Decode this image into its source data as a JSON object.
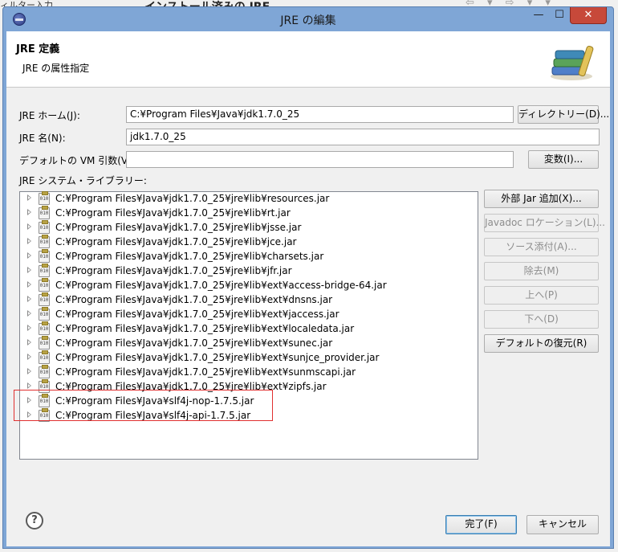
{
  "background": {
    "left_text": "ィルター入力",
    "title": "インストール済みの JRE",
    "nav": "⇦ ▾ ⇨ ▾ ▾"
  },
  "window": {
    "title": "JRE の編集",
    "minimize": "—",
    "maximize": "☐",
    "close": "✕"
  },
  "header": {
    "title": "JRE 定義",
    "description": "JRE の属性指定",
    "icon": "library-books-icon"
  },
  "form": {
    "jre_home_label": "JRE ホーム(J):",
    "jre_home_value": "C:¥Program Files¥Java¥jdk1.7.0_25",
    "directory_button": "ディレクトリー(D)...",
    "jre_name_label": "JRE 名(N):",
    "jre_name_value": "jdk1.7.0_25",
    "vm_args_label": "デフォルトの VM 引数(V):",
    "vm_args_value": "",
    "variables_button": "変数(I)...",
    "libraries_label": "JRE システム・ライブラリー:"
  },
  "libraries": [
    "C:¥Program Files¥Java¥jdk1.7.0_25¥jre¥lib¥resources.jar",
    "C:¥Program Files¥Java¥jdk1.7.0_25¥jre¥lib¥rt.jar",
    "C:¥Program Files¥Java¥jdk1.7.0_25¥jre¥lib¥jsse.jar",
    "C:¥Program Files¥Java¥jdk1.7.0_25¥jre¥lib¥jce.jar",
    "C:¥Program Files¥Java¥jdk1.7.0_25¥jre¥lib¥charsets.jar",
    "C:¥Program Files¥Java¥jdk1.7.0_25¥jre¥lib¥jfr.jar",
    "C:¥Program Files¥Java¥jdk1.7.0_25¥jre¥lib¥ext¥access-bridge-64.jar",
    "C:¥Program Files¥Java¥jdk1.7.0_25¥jre¥lib¥ext¥dnsns.jar",
    "C:¥Program Files¥Java¥jdk1.7.0_25¥jre¥lib¥ext¥jaccess.jar",
    "C:¥Program Files¥Java¥jdk1.7.0_25¥jre¥lib¥ext¥localedata.jar",
    "C:¥Program Files¥Java¥jdk1.7.0_25¥jre¥lib¥ext¥sunec.jar",
    "C:¥Program Files¥Java¥jdk1.7.0_25¥jre¥lib¥ext¥sunjce_provider.jar",
    "C:¥Program Files¥Java¥jdk1.7.0_25¥jre¥lib¥ext¥sunmscapi.jar",
    "C:¥Program Files¥Java¥jdk1.7.0_25¥jre¥lib¥ext¥zipfs.jar",
    "C:¥Program Files¥Java¥slf4j-nop-1.7.5.jar",
    "C:¥Program Files¥Java¥slf4j-api-1.7.5.jar"
  ],
  "side_buttons": {
    "add_external_jar": "外部 Jar 追加(X)...",
    "javadoc_location": "Javadoc ロケーション(L)...",
    "source_attachment": "ソース添付(A)...",
    "remove": "除去(M)",
    "up": "上へ(P)",
    "down": "下へ(D)",
    "restore_default": "デフォルトの復元(R)"
  },
  "footer": {
    "help": "?",
    "finish": "完了(F)",
    "cancel": "キャンセル"
  },
  "colors": {
    "window_frame": "#7fa6d6",
    "close_button": "#c7493a",
    "highlight_border": "#e03030"
  }
}
